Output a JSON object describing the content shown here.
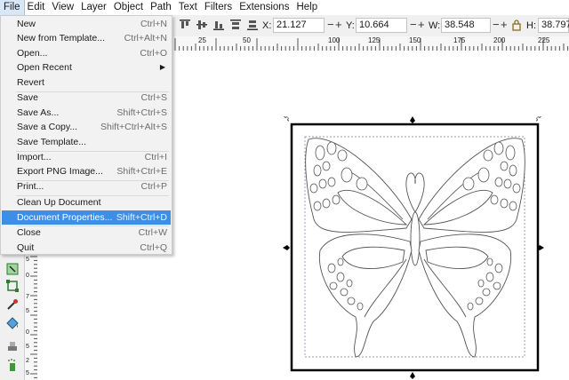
{
  "menubar": [
    "File",
    "Edit",
    "View",
    "Layer",
    "Object",
    "Path",
    "Text",
    "Filters",
    "Extensions",
    "Help"
  ],
  "file_menu": [
    {
      "label": "New",
      "shortcut": "Ctrl+N"
    },
    {
      "label": "New from Template...",
      "shortcut": "Ctrl+Alt+N"
    },
    {
      "label": "Open...",
      "shortcut": "Ctrl+O"
    },
    {
      "label": "Open Recent",
      "shortcut": ""
    },
    {
      "label": "Revert",
      "shortcut": ""
    },
    {
      "label": "Save",
      "shortcut": "Ctrl+S"
    },
    {
      "label": "Save As...",
      "shortcut": "Shift+Ctrl+S"
    },
    {
      "label": "Save a Copy...",
      "shortcut": "Shift+Ctrl+Alt+S"
    },
    {
      "label": "Save Template...",
      "shortcut": ""
    },
    {
      "label": "Import...",
      "shortcut": "Ctrl+I"
    },
    {
      "label": "Export PNG Image...",
      "shortcut": "Shift+Ctrl+E"
    },
    {
      "label": "Print...",
      "shortcut": "Ctrl+P"
    },
    {
      "label": "Clean Up Document",
      "shortcut": ""
    },
    {
      "label": "Document Properties...",
      "shortcut": "Shift+Ctrl+D"
    },
    {
      "label": "Close",
      "shortcut": "Ctrl+W"
    },
    {
      "label": "Quit",
      "shortcut": "Ctrl+Q"
    }
  ],
  "toolbar": {
    "x_label": "X:",
    "x_value": "21.127",
    "y_label": "Y:",
    "y_value": "10.664",
    "w_label": "W:",
    "w_value": "38.548",
    "h_label": "H:",
    "h_value": "38.797",
    "minus": "−",
    "plus": "+"
  },
  "ruler": {
    "h_ticks": [
      "25",
      "50",
      "100",
      "125",
      "150",
      "175",
      "200",
      "225"
    ],
    "v_ticks": [
      "5",
      "0",
      "7",
      "5",
      "0",
      "5",
      "2",
      "5"
    ]
  },
  "colors": {
    "selection": "#3d8ee6",
    "menu_bg": "#f2f2f2",
    "page_border": "#000000"
  }
}
